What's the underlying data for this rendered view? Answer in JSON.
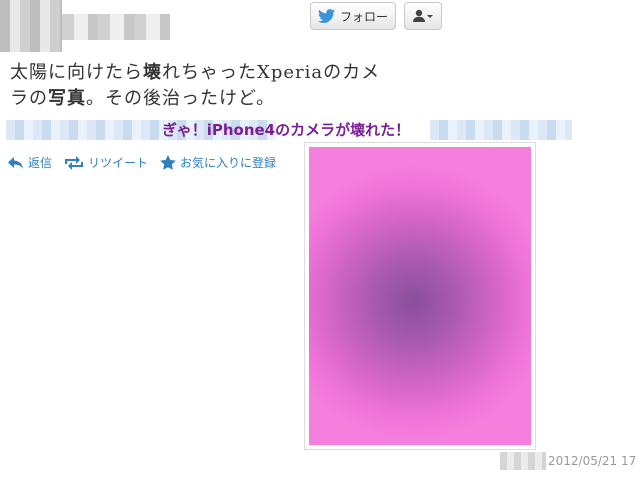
{
  "header": {
    "follow_label": "フォロー",
    "follow_icon": "twitter-bird-icon",
    "user_menu_icon": "person-dropdown-icon"
  },
  "tweet": {
    "text_line1_a": "太陽に向けたら",
    "text_line1_b": "壊",
    "text_line1_c": "れちゃった",
    "text_line1_d": "Xperia",
    "text_line1_e": "のカメ",
    "text_line2_a": "ラの",
    "text_line2_b": "写真",
    "text_line2_c": "。その後治ったけど。",
    "headline": "ぎゃ！iPhone4のカメラが壊れた！",
    "headline_color": "#7a1f98"
  },
  "actions": {
    "reply": "返信",
    "retweet": "リツイート",
    "favorite": "お気に入りに登録",
    "color": "#2f7fc1"
  },
  "photo": {
    "colors": [
      "#f57fdd",
      "#d566c8",
      "#8a4f9a"
    ]
  },
  "footer": {
    "timestamp": "2012/05/21 17"
  }
}
